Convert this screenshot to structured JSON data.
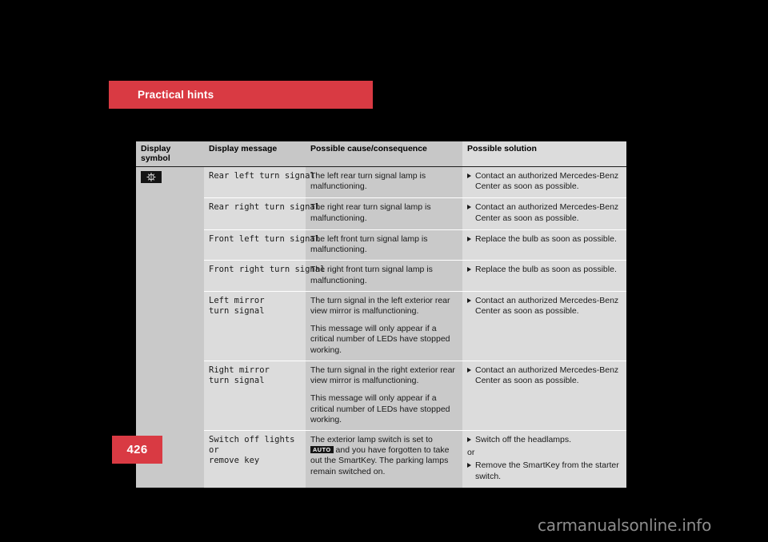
{
  "chapter": {
    "title": "Practical hints"
  },
  "page": {
    "number": "426"
  },
  "footer": {
    "watermark": "carmanualsonline.info"
  },
  "colors": {
    "accent_red": "#d93a43",
    "page_background": "#000000",
    "table_col_dark": "#c9c9c9",
    "table_col_light": "#dcdcdc",
    "header_background": "#c7c7c7"
  },
  "table": {
    "headers": [
      "Display symbol",
      "Display message",
      "Possible cause/consequence",
      "Possible solution"
    ],
    "symbol": {
      "name": "bulb-failure-indicator-icon",
      "label": "bulb failure warning lamp"
    },
    "rows": [
      {
        "message": [
          "Rear left turn signal"
        ],
        "cause": [
          "The left rear turn signal lamp is malfunctioning."
        ],
        "solution": [
          {
            "type": "bullet",
            "text": "Contact an authorized Mercedes-Benz Center as soon as possible."
          }
        ]
      },
      {
        "message": [
          "Rear right turn signal"
        ],
        "cause": [
          "The right rear turn signal lamp is malfunctioning."
        ],
        "solution": [
          {
            "type": "bullet",
            "text": "Contact an authorized Mercedes-Benz Center as soon as possible."
          }
        ]
      },
      {
        "message": [
          "Front left turn signal"
        ],
        "cause": [
          "The left front turn signal lamp is malfunctioning."
        ],
        "solution": [
          {
            "type": "bullet",
            "text": "Replace the bulb as soon as possible."
          }
        ]
      },
      {
        "message": [
          "Front right turn signal"
        ],
        "cause": [
          "The right front turn signal lamp is malfunctioning."
        ],
        "solution": [
          {
            "type": "bullet",
            "text": "Replace the bulb as soon as possible."
          }
        ]
      },
      {
        "message": [
          "Left mirror",
          "turn signal"
        ],
        "cause": [
          "The turn signal in the left exterior rear view mirror is malfunctioning.",
          "This message will only appear if a critical number of LEDs have stopped working."
        ],
        "solution": [
          {
            "type": "bullet",
            "text": "Contact an authorized Mercedes-Benz Center as soon as possible."
          }
        ]
      },
      {
        "message": [
          "Right mirror",
          "turn signal"
        ],
        "cause": [
          "The turn signal in the right exterior rear view mirror is malfunctioning.",
          "This message will only appear if a critical number of LEDs have stopped working."
        ],
        "solution": [
          {
            "type": "bullet",
            "text": "Contact an authorized Mercedes-Benz Center as soon as possible."
          }
        ]
      },
      {
        "message": [
          "Switch off lights",
          "or",
          "remove key"
        ],
        "cause_prefix": "The exterior lamp switch is set to",
        "cause_badge": "AUTO",
        "cause_suffix": "and you have forgotten to take out the SmartKey. The parking lamps remain switched on.",
        "cause": [],
        "solution": [
          {
            "type": "bullet",
            "text": "Switch off the headlamps."
          },
          {
            "type": "or",
            "text": "or"
          },
          {
            "type": "bullet",
            "text": "Remove the SmartKey from the starter switch."
          }
        ]
      }
    ]
  }
}
